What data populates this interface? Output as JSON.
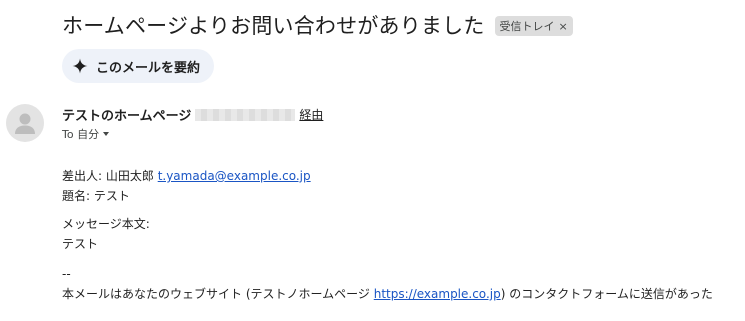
{
  "email": {
    "subject": "ホームページよりお問い合わせがありました",
    "label": {
      "text": "受信トレイ",
      "close": "×"
    },
    "summarize_button": {
      "icon": "sparkle-icon",
      "label": "このメールを要約"
    },
    "sender": {
      "avatar_icon": "person-icon",
      "name": "テストのホームページ",
      "via": "経由"
    },
    "recipient": {
      "text": "To 自分"
    },
    "body": {
      "from_label": "差出人: 山田太郎",
      "from_email": "t.yamada@example.co.jp",
      "title_line": "題名: テスト",
      "message_label": "メッセージ本文:",
      "message_text": "テスト",
      "separator": "--",
      "footer_prefix": "本メールはあなたのウェブサイト (テストノホームページ",
      "footer_link": "https://example.co.jp",
      "footer_suffix": ") のコンタクトフォームに送信があった"
    }
  },
  "colors": {
    "link": "#1a55c4",
    "summarize_bg": "#eef2f9",
    "chip_bg": "#dddddd",
    "avatar_bg": "#e3e3e3"
  }
}
